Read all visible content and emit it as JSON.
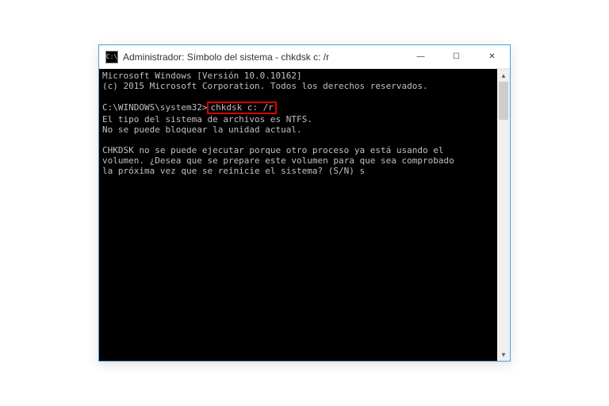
{
  "window": {
    "title": "Administrador: Símbolo del sistema - chkdsk  c: /r",
    "icon_glyph": "C:\\"
  },
  "controls": {
    "minimize": "—",
    "maximize": "☐",
    "close": "✕"
  },
  "console": {
    "line_version": "Microsoft Windows [Versión 10.0.10162]",
    "line_copyright": "(c) 2015 Microsoft Corporation. Todos los derechos reservados.",
    "prompt_path": "C:\\WINDOWS\\system32>",
    "typed_command": "chkdsk c: /r",
    "fs_line": "El tipo del sistema de archivos es NTFS.",
    "lock_line": "No se puede bloquear la unidad actual.",
    "msg_line1": "CHKDSK no se puede ejecutar porque otro proceso ya está usando el",
    "msg_line2": "volumen. ¿Desea que se prepare este volumen para que sea comprobado",
    "msg_line3": "la próxima vez que se reinicie el sistema? (S/N) ",
    "user_response": "s"
  },
  "scrollbar": {
    "up": "▲",
    "down": "▼"
  }
}
